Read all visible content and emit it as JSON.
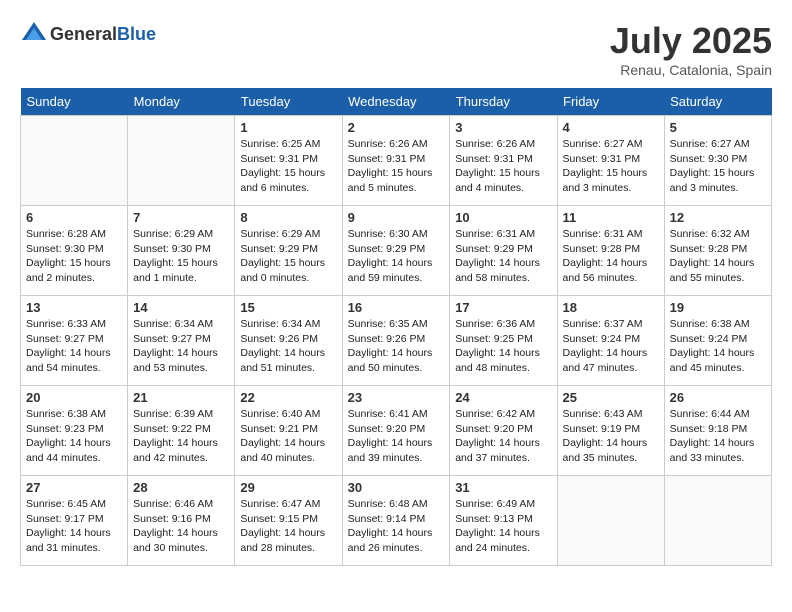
{
  "header": {
    "logo_general": "General",
    "logo_blue": "Blue",
    "month": "July 2025",
    "location": "Renau, Catalonia, Spain"
  },
  "days_of_week": [
    "Sunday",
    "Monday",
    "Tuesday",
    "Wednesday",
    "Thursday",
    "Friday",
    "Saturday"
  ],
  "weeks": [
    [
      {
        "day": "",
        "info": ""
      },
      {
        "day": "",
        "info": ""
      },
      {
        "day": "1",
        "info": "Sunrise: 6:25 AM\nSunset: 9:31 PM\nDaylight: 15 hours\nand 6 minutes."
      },
      {
        "day": "2",
        "info": "Sunrise: 6:26 AM\nSunset: 9:31 PM\nDaylight: 15 hours\nand 5 minutes."
      },
      {
        "day": "3",
        "info": "Sunrise: 6:26 AM\nSunset: 9:31 PM\nDaylight: 15 hours\nand 4 minutes."
      },
      {
        "day": "4",
        "info": "Sunrise: 6:27 AM\nSunset: 9:31 PM\nDaylight: 15 hours\nand 3 minutes."
      },
      {
        "day": "5",
        "info": "Sunrise: 6:27 AM\nSunset: 9:30 PM\nDaylight: 15 hours\nand 3 minutes."
      }
    ],
    [
      {
        "day": "6",
        "info": "Sunrise: 6:28 AM\nSunset: 9:30 PM\nDaylight: 15 hours\nand 2 minutes."
      },
      {
        "day": "7",
        "info": "Sunrise: 6:29 AM\nSunset: 9:30 PM\nDaylight: 15 hours\nand 1 minute."
      },
      {
        "day": "8",
        "info": "Sunrise: 6:29 AM\nSunset: 9:29 PM\nDaylight: 15 hours\nand 0 minutes."
      },
      {
        "day": "9",
        "info": "Sunrise: 6:30 AM\nSunset: 9:29 PM\nDaylight: 14 hours\nand 59 minutes."
      },
      {
        "day": "10",
        "info": "Sunrise: 6:31 AM\nSunset: 9:29 PM\nDaylight: 14 hours\nand 58 minutes."
      },
      {
        "day": "11",
        "info": "Sunrise: 6:31 AM\nSunset: 9:28 PM\nDaylight: 14 hours\nand 56 minutes."
      },
      {
        "day": "12",
        "info": "Sunrise: 6:32 AM\nSunset: 9:28 PM\nDaylight: 14 hours\nand 55 minutes."
      }
    ],
    [
      {
        "day": "13",
        "info": "Sunrise: 6:33 AM\nSunset: 9:27 PM\nDaylight: 14 hours\nand 54 minutes."
      },
      {
        "day": "14",
        "info": "Sunrise: 6:34 AM\nSunset: 9:27 PM\nDaylight: 14 hours\nand 53 minutes."
      },
      {
        "day": "15",
        "info": "Sunrise: 6:34 AM\nSunset: 9:26 PM\nDaylight: 14 hours\nand 51 minutes."
      },
      {
        "day": "16",
        "info": "Sunrise: 6:35 AM\nSunset: 9:26 PM\nDaylight: 14 hours\nand 50 minutes."
      },
      {
        "day": "17",
        "info": "Sunrise: 6:36 AM\nSunset: 9:25 PM\nDaylight: 14 hours\nand 48 minutes."
      },
      {
        "day": "18",
        "info": "Sunrise: 6:37 AM\nSunset: 9:24 PM\nDaylight: 14 hours\nand 47 minutes."
      },
      {
        "day": "19",
        "info": "Sunrise: 6:38 AM\nSunset: 9:24 PM\nDaylight: 14 hours\nand 45 minutes."
      }
    ],
    [
      {
        "day": "20",
        "info": "Sunrise: 6:38 AM\nSunset: 9:23 PM\nDaylight: 14 hours\nand 44 minutes."
      },
      {
        "day": "21",
        "info": "Sunrise: 6:39 AM\nSunset: 9:22 PM\nDaylight: 14 hours\nand 42 minutes."
      },
      {
        "day": "22",
        "info": "Sunrise: 6:40 AM\nSunset: 9:21 PM\nDaylight: 14 hours\nand 40 minutes."
      },
      {
        "day": "23",
        "info": "Sunrise: 6:41 AM\nSunset: 9:20 PM\nDaylight: 14 hours\nand 39 minutes."
      },
      {
        "day": "24",
        "info": "Sunrise: 6:42 AM\nSunset: 9:20 PM\nDaylight: 14 hours\nand 37 minutes."
      },
      {
        "day": "25",
        "info": "Sunrise: 6:43 AM\nSunset: 9:19 PM\nDaylight: 14 hours\nand 35 minutes."
      },
      {
        "day": "26",
        "info": "Sunrise: 6:44 AM\nSunset: 9:18 PM\nDaylight: 14 hours\nand 33 minutes."
      }
    ],
    [
      {
        "day": "27",
        "info": "Sunrise: 6:45 AM\nSunset: 9:17 PM\nDaylight: 14 hours\nand 31 minutes."
      },
      {
        "day": "28",
        "info": "Sunrise: 6:46 AM\nSunset: 9:16 PM\nDaylight: 14 hours\nand 30 minutes."
      },
      {
        "day": "29",
        "info": "Sunrise: 6:47 AM\nSunset: 9:15 PM\nDaylight: 14 hours\nand 28 minutes."
      },
      {
        "day": "30",
        "info": "Sunrise: 6:48 AM\nSunset: 9:14 PM\nDaylight: 14 hours\nand 26 minutes."
      },
      {
        "day": "31",
        "info": "Sunrise: 6:49 AM\nSunset: 9:13 PM\nDaylight: 14 hours\nand 24 minutes."
      },
      {
        "day": "",
        "info": ""
      },
      {
        "day": "",
        "info": ""
      }
    ]
  ]
}
